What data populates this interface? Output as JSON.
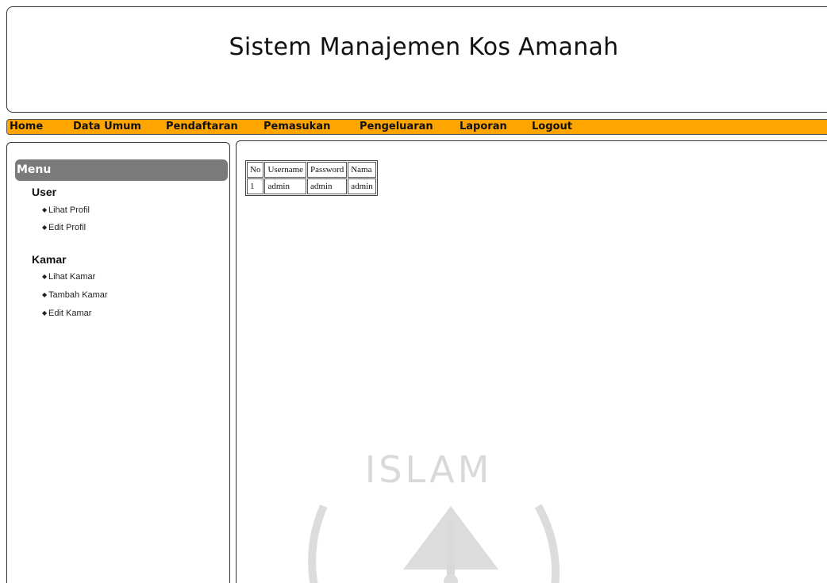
{
  "header": {
    "title": "Sistem Manajemen Kos Amanah"
  },
  "nav": {
    "items": [
      "Home",
      "Data Umum",
      "Pendaftaran",
      "Pemasukan",
      "Pengeluaran",
      "Laporan",
      "Logout"
    ]
  },
  "sidebar": {
    "menu_label": "Menu",
    "sections": [
      {
        "title": "User",
        "links": [
          "Lihat Profil",
          "Edit Profil"
        ]
      },
      {
        "title": "Kamar",
        "links": [
          "Lihat Kamar",
          "Tambah Kamar",
          "Edit Kamar"
        ]
      }
    ]
  },
  "table": {
    "headers": [
      "No",
      "Username",
      "Password",
      "Nama"
    ],
    "rows": [
      [
        "1",
        "admin",
        "admin",
        "admin"
      ]
    ]
  },
  "watermark": {
    "text": "ISLAM"
  },
  "colors": {
    "nav_bg": "#ffa500",
    "menu_header_bg": "#7a7a7a"
  }
}
